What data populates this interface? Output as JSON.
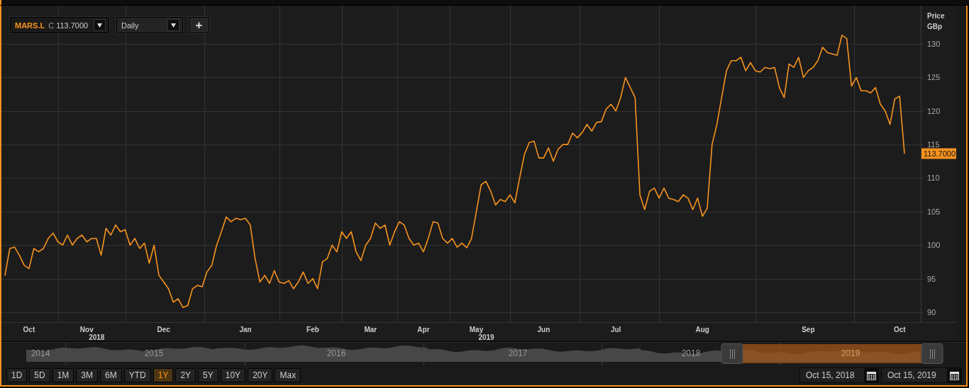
{
  "toolbar": {
    "close_label": "C",
    "close_value": "113.7000",
    "interval": "Daily",
    "add_button": "+"
  },
  "price_chart": {
    "axis_title": "Price",
    "axis_unit": "GBp",
    "last_price_label": "113.7000",
    "year_labels": [
      "2018",
      "2019"
    ],
    "chart_data": {
      "type": "line",
      "grid": true,
      "ylim": [
        88.52,
        135.7
      ],
      "yticks": [
        90,
        95,
        100,
        105,
        110,
        115,
        120,
        125,
        130
      ],
      "categories": [
        null,
        null,
        null,
        null,
        null,
        "Oct",
        null,
        null,
        null,
        null,
        null,
        null,
        null,
        null,
        null,
        null,
        null,
        "Nov",
        null,
        null,
        null,
        null,
        null,
        null,
        null,
        null,
        null,
        null,
        null,
        null,
        null,
        null,
        null,
        "Dec",
        null,
        null,
        null,
        null,
        null,
        null,
        null,
        null,
        null,
        null,
        null,
        null,
        null,
        null,
        null,
        null,
        "Jan",
        null,
        null,
        null,
        null,
        null,
        null,
        null,
        null,
        null,
        null,
        null,
        null,
        null,
        "Feb",
        null,
        null,
        null,
        null,
        null,
        null,
        null,
        null,
        null,
        null,
        null,
        "Mar",
        null,
        null,
        null,
        null,
        null,
        null,
        null,
        null,
        null,
        null,
        "Apr",
        null,
        null,
        null,
        null,
        null,
        null,
        null,
        null,
        null,
        null,
        "May",
        null,
        null,
        null,
        null,
        null,
        null,
        null,
        null,
        null,
        null,
        null,
        null,
        null,
        "Jun",
        null,
        null,
        null,
        null,
        null,
        null,
        null,
        null,
        null,
        null,
        null,
        null,
        null,
        null,
        "Jul",
        null,
        null,
        null,
        null,
        null,
        null,
        null,
        null,
        null,
        null,
        null,
        null,
        null,
        null,
        null,
        null,
        null,
        "Aug",
        null,
        null,
        null,
        null,
        null,
        null,
        null,
        null,
        null,
        null,
        null,
        null,
        null,
        null,
        null,
        null,
        null,
        null,
        null,
        null,
        null,
        "Sep",
        null,
        null,
        null,
        null,
        null,
        null,
        null,
        null,
        null,
        null,
        null,
        null,
        null,
        null,
        null,
        null,
        null,
        null,
        "Oct",
        null
      ],
      "series": [
        {
          "name": "MARS.L",
          "color": "#f7931e",
          "values": [
            95.5,
            99.5,
            99.7,
            98.5,
            97,
            96.5,
            99.5,
            99,
            99.5,
            101,
            101.8,
            100.5,
            100,
            101.5,
            100,
            101,
            101.5,
            100.5,
            101,
            101,
            98.5,
            102.5,
            101.5,
            103,
            102,
            102.3,
            100,
            101,
            99.5,
            100.3,
            97.3,
            100,
            95.5,
            94.5,
            93.5,
            91.5,
            92,
            90.7,
            91,
            93.5,
            94,
            93.8,
            96,
            97,
            100,
            102,
            104.2,
            103.5,
            104,
            103.8,
            104,
            103,
            98,
            94.5,
            95.5,
            94.3,
            96.2,
            94.5,
            94.3,
            94.7,
            93.5,
            94.5,
            96,
            94.3,
            95,
            93.5,
            97.5,
            98,
            100,
            99,
            102,
            101,
            102,
            99,
            97.7,
            100,
            101,
            103.3,
            102.5,
            103,
            100,
            102,
            103.5,
            103,
            101,
            100,
            100.3,
            99,
            101,
            103.5,
            103.3,
            101,
            100.3,
            101,
            99.7,
            100.3,
            99.6,
            101,
            105,
            109,
            109.5,
            108,
            106,
            106.8,
            106.5,
            107.5,
            106.3,
            110,
            113.5,
            115.3,
            115.5,
            113,
            113,
            114.5,
            112.5,
            114.3,
            115,
            115,
            116.7,
            116,
            116.8,
            118,
            117,
            118.3,
            118.4,
            120.3,
            121,
            120,
            122,
            125,
            123.5,
            122,
            107.5,
            105.3,
            108,
            108.5,
            107,
            108.5,
            107,
            106.8,
            106.5,
            107.5,
            107,
            105.3,
            107,
            104.3,
            105.5,
            115,
            118,
            122,
            126,
            127.5,
            127.5,
            128,
            126,
            127.2,
            126,
            125.8,
            126.5,
            126.3,
            126.5,
            123.5,
            122,
            127,
            126.5,
            128,
            125,
            126,
            126.5,
            127.5,
            129.5,
            128.7,
            128.5,
            128.3,
            131.3,
            130.8,
            123.7,
            125,
            123,
            123,
            122.7,
            123.5,
            121,
            120,
            118,
            121.8,
            122.2,
            113.7
          ]
        }
      ]
    }
  },
  "navigator": {
    "years": [
      "2014",
      "2015",
      "2016",
      "2017",
      "2018",
      "2019"
    ]
  },
  "range_buttons": [
    {
      "label": "1D",
      "selected": false
    },
    {
      "label": "5D",
      "selected": false
    },
    {
      "label": "1M",
      "selected": false
    },
    {
      "label": "3M",
      "selected": false
    },
    {
      "label": "6M",
      "selected": false
    },
    {
      "label": "YTD",
      "selected": false
    },
    {
      "label": "1Y",
      "selected": true
    },
    {
      "label": "2Y",
      "selected": false
    },
    {
      "label": "5Y",
      "selected": false
    },
    {
      "label": "10Y",
      "selected": false
    },
    {
      "label": "20Y",
      "selected": false
    },
    {
      "label": "Max",
      "selected": false
    }
  ],
  "date_range": {
    "start": "Oct 15, 2018",
    "end": "Oct 15, 2019"
  }
}
